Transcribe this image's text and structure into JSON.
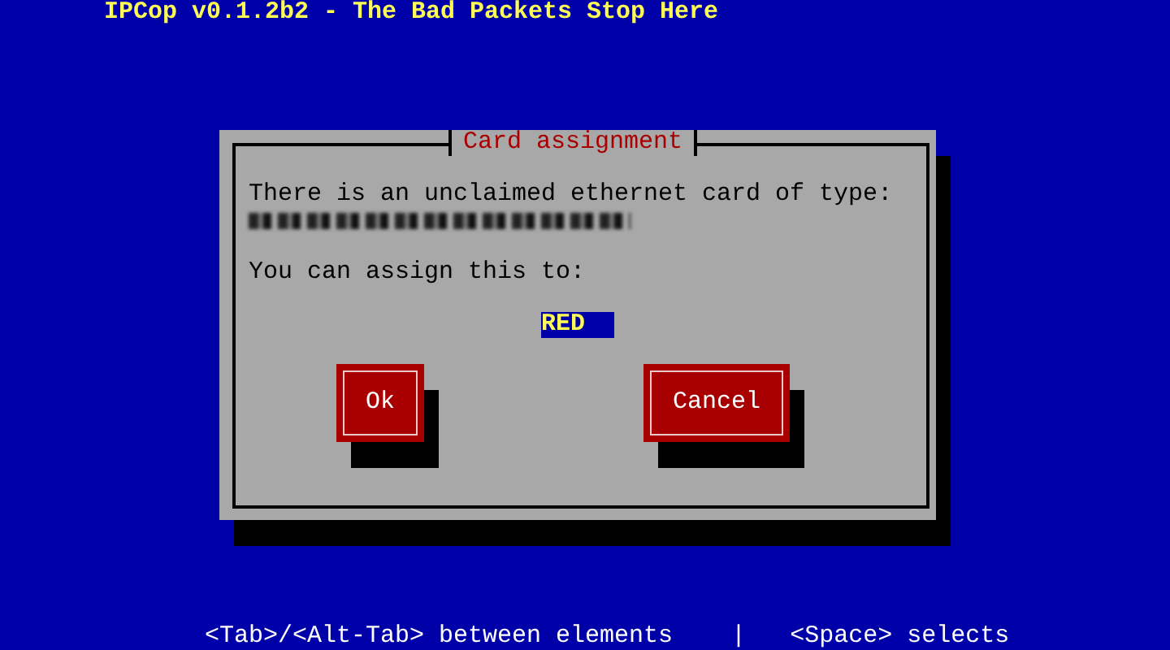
{
  "header": {
    "title": "IPCop v0.1.2b2 - The Bad Packets Stop Here"
  },
  "dialog": {
    "title": "Card assignment",
    "message": "There is an unclaimed ethernet card of type:",
    "prompt": "You can assign this to:",
    "listbox": {
      "items": [
        {
          "label": "RED",
          "selected": true
        }
      ]
    },
    "buttons": [
      {
        "label": "Ok"
      },
      {
        "label": "Cancel"
      }
    ]
  },
  "status_bar": {
    "left": "<Tab>/<Alt-Tab> between elements",
    "separator": "|",
    "right": "<Space> selects"
  }
}
